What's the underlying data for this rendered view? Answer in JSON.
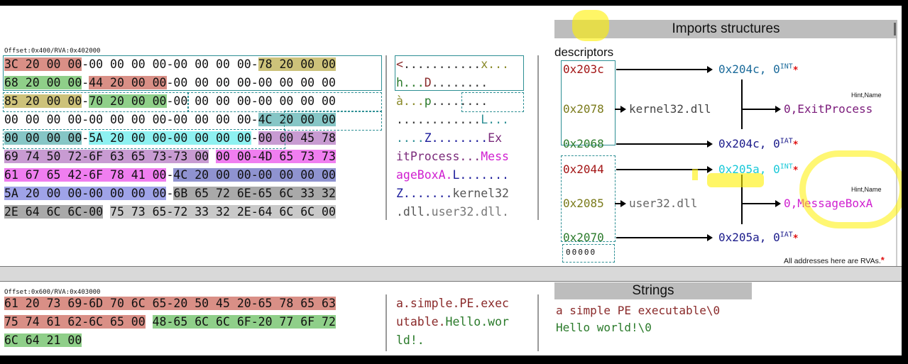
{
  "hex_top": {
    "offset_label": "Offset:0x400/RVA:0x402000",
    "rows": [
      [
        {
          "t": "3C 20 00 00",
          "c": "#d98f86"
        },
        {
          "t": "-00 00 00 00-00 00 00 00-",
          "c": ""
        },
        {
          "t": "78 20 00 00",
          "c": "#cdc27a"
        }
      ],
      [
        {
          "t": "68 20 00 00",
          "c": "#8fcf89"
        },
        {
          "t": "-",
          "c": ""
        },
        {
          "t": "44 20 00 00",
          "c": "#d98f86"
        },
        {
          "t": "-00 00 00 00-00 00 00 00",
          "c": ""
        }
      ],
      [
        {
          "t": "85 20 00 00",
          "c": "#cdc27a"
        },
        {
          "t": "-",
          "c": ""
        },
        {
          "t": "70 20 00 00",
          "c": "#8fcf89"
        },
        {
          "t": "-00 00 00 00-00 00 00 00",
          "c": ""
        }
      ],
      [
        {
          "t": "00 00 00 00-00 00 00 00-00 00 00 00-",
          "c": ""
        },
        {
          "t": "4C 20 00 00",
          "c": "#86c6c6"
        }
      ],
      [
        {
          "t": "00 00 00 00",
          "c": "#86c6c6"
        },
        {
          "t": "-",
          "c": ""
        },
        {
          "t": "5A 20 00 00-00 00 00 00",
          "c": "#8ef1f1"
        },
        {
          "t": "-",
          "c": ""
        },
        {
          "t": "00 00 45 78",
          "c": "#c89bd2"
        }
      ],
      [
        {
          "t": "69 74 50 72-6F 63 65 73-73 00",
          "c": "#c89bd2"
        },
        {
          "t": " ",
          "c": ""
        },
        {
          "t": "00 00-4D 65 73 73",
          "c": "#f07ef0"
        }
      ],
      [
        {
          "t": "61 67 65 42-6F 78 41 00",
          "c": "#f07ef0"
        },
        {
          "t": "-",
          "c": ""
        },
        {
          "t": "4C 20 00 00-00 00 00 00",
          "c": "#8f93d0"
        }
      ],
      [
        {
          "t": "5A 20 00 00-00 00 00 00",
          "c": "#9fa3e8"
        },
        {
          "t": "-",
          "c": ""
        },
        {
          "t": "6B 65 72 6E-65 6C 33 32",
          "c": "#a9a9a9"
        }
      ],
      [
        {
          "t": "2E 64 6C 6C-00",
          "c": "#a9a9a9"
        },
        {
          "t": " ",
          "c": ""
        },
        {
          "t": "75 73 65-72 33 32 2E-64 6C 6C 00",
          "c": "#c9c9c9"
        }
      ]
    ]
  },
  "ascii_top": {
    "rows": [
      [
        {
          "t": "<",
          "c": "#8a2a2a"
        },
        {
          "t": "...........",
          "c": "#333"
        },
        {
          "t": "x...",
          "c": "#8a8a2a"
        }
      ],
      [
        {
          "t": "h...",
          "c": "#2a7a2a"
        },
        {
          "t": "D",
          "c": "#8a2a2a"
        },
        {
          "t": "........",
          "c": "#333"
        }
      ],
      [
        {
          "t": "à...",
          "c": "#8a8a2a"
        },
        {
          "t": "p",
          "c": "#2a7a2a"
        },
        {
          "t": "........",
          "c": "#333"
        }
      ],
      [
        {
          "t": "............",
          "c": "#333"
        },
        {
          "t": "L...",
          "c": "#2d8f94"
        }
      ],
      [
        {
          "t": "....",
          "c": "#2d8f94"
        },
        {
          "t": "Z........",
          "c": "#1a1a9a"
        },
        {
          "t": "Ex",
          "c": "#7a2a7a"
        }
      ],
      [
        {
          "t": "itProcess...",
          "c": "#7a2a7a"
        },
        {
          "t": "Mess",
          "c": "#d020d0"
        }
      ],
      [
        {
          "t": "ageBoxA.",
          "c": "#d020d0"
        },
        {
          "t": "L.......",
          "c": "#1a1a9a"
        }
      ],
      [
        {
          "t": "Z.......",
          "c": "#1a1a9a"
        },
        {
          "t": "kernel32",
          "c": "#555"
        }
      ],
      [
        {
          "t": ".dll.",
          "c": "#555"
        },
        {
          "t": "user32.dll.",
          "c": "#777"
        }
      ]
    ]
  },
  "imports": {
    "title": "Imports structures",
    "descriptors_label": "descriptors",
    "kernel": {
      "int": "0x203c",
      "name": "0x2078",
      "iat": "0x2068",
      "dll": "kernel32.dll",
      "int_target": "0x204c, 0",
      "iat_target": "0x204c, 0",
      "hint": "0,ExitProcess"
    },
    "user": {
      "int": "0x2044",
      "name": "0x2085",
      "iat": "0x2070",
      "dll": "user32.dll",
      "int_target": "0x205a, 0",
      "iat_target": "0x205a, 0",
      "hint": "0,MessageBoxA"
    },
    "sup_int": "INT",
    "sup_iat": "IAT",
    "hint_label": "Hint,Name",
    "star": "*",
    "terminator": "00000",
    "footnote": "All addresses here are RVAs."
  },
  "hex_bottom": {
    "offset_label": "Offset:0x600/RVA:0x403000",
    "rows": [
      [
        {
          "t": "61 20 73 69-6D 70 6C 65-20 50 45 20-65 78 65 63",
          "c": "#d98f86"
        }
      ],
      [
        {
          "t": "75 74 61 62-6C 65 00",
          "c": "#d98f86"
        },
        {
          "t": " ",
          "c": ""
        },
        {
          "t": "48-65 6C 6C 6F-20 77 6F 72",
          "c": "#8fcf89"
        }
      ],
      [
        {
          "t": "6C 64 21 00",
          "c": "#8fcf89"
        }
      ]
    ]
  },
  "ascii_bottom": {
    "rows": [
      [
        {
          "t": "a.simple.PE.exec",
          "c": "#8a2a2a"
        }
      ],
      [
        {
          "t": "utable.",
          "c": "#8a2a2a"
        },
        {
          "t": "Hello.wor",
          "c": "#2a7a2a"
        }
      ],
      [
        {
          "t": "ld!.",
          "c": "#2a7a2a"
        }
      ]
    ]
  },
  "strings": {
    "title": "Strings",
    "s1": "a simple PE executable\\0",
    "s2": "Hello world!\\0"
  }
}
